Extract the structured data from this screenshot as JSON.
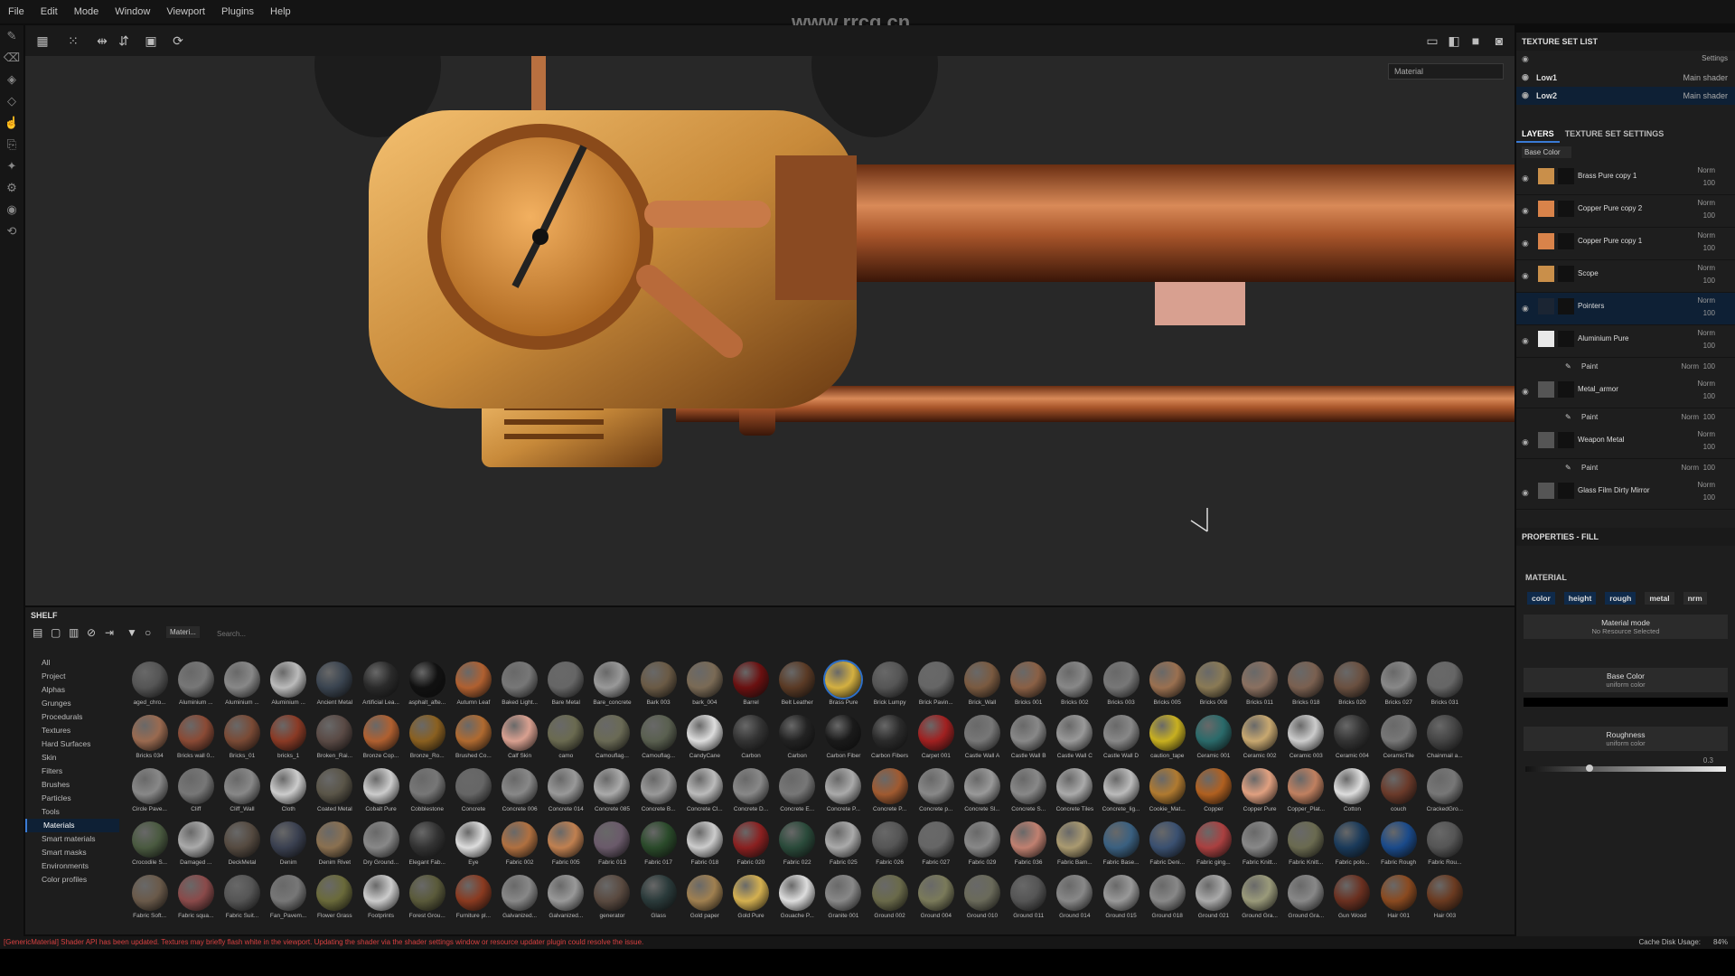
{
  "menu": [
    "File",
    "Edit",
    "Mode",
    "Window",
    "Viewport",
    "Plugins",
    "Help"
  ],
  "watermark": "www.rrcg.cn",
  "viewport": {
    "mode_select": "Material"
  },
  "texture_set_list": {
    "title": "TEXTURE SET LIST",
    "settings": "Settings",
    "items": [
      {
        "name": "Low1",
        "shader": "Main shader"
      },
      {
        "name": "Low2",
        "shader": "Main shader"
      }
    ]
  },
  "layers_panel": {
    "tabs": [
      "LAYERS",
      "TEXTURE SET SETTINGS"
    ],
    "channel": "Base Color",
    "layers": [
      {
        "name": "Brass Pure copy 1",
        "blend": "Norm",
        "opacity": "100",
        "color": "#c98f4a"
      },
      {
        "name": "Copper Pure copy 2",
        "blend": "Norm",
        "opacity": "100",
        "color": "#d9834a"
      },
      {
        "name": "Copper Pure copy 1",
        "blend": "Norm",
        "opacity": "100",
        "color": "#d9834a"
      },
      {
        "name": "Scope",
        "blend": "Norm",
        "opacity": "100",
        "color": "#c98f4a"
      },
      {
        "name": "Pointers",
        "blend": "Norm",
        "opacity": "100",
        "color": "#1b2533"
      },
      {
        "name": "Aluminium Pure",
        "blend": "Norm",
        "opacity": "100",
        "color": "#e8e8e8"
      },
      {
        "name": "Metal_armor",
        "blend": "Norm",
        "opacity": "100",
        "color": "#555"
      },
      {
        "name": "Weapon Metal",
        "blend": "Norm",
        "opacity": "100",
        "color": "#555"
      },
      {
        "name": "Glass Film Dirty Mirror",
        "blend": "Norm",
        "opacity": "100",
        "color": "#555"
      }
    ],
    "paint_label": "Paint",
    "paint_blend": "Norm",
    "paint_opacity": "100"
  },
  "properties": {
    "title": "PROPERTIES - FILL",
    "section": "MATERIAL",
    "channels": [
      "color",
      "height",
      "rough",
      "metal",
      "nrm"
    ],
    "material_mode": "Material mode",
    "no_resource": "No Resource Selected",
    "base_color": "Base Color",
    "uniform_color": "uniform color",
    "roughness": "Roughness",
    "roughness_value": "0.3"
  },
  "shelf": {
    "title": "SHELF",
    "filter_tag": "Materi...",
    "search_placeholder": "Search...",
    "categories": [
      "All",
      "Project",
      "Alphas",
      "Grunges",
      "Procedurals",
      "Textures",
      "Hard Surfaces",
      "Skin",
      "Filters",
      "Brushes",
      "Particles",
      "Tools",
      "Materials",
      "Smart materials",
      "Smart masks",
      "Environments",
      "Color profiles"
    ],
    "selected_category": "Materials",
    "materials": [
      {
        "n": "aged_chro...",
        "c": "#555"
      },
      {
        "n": "Aluminium ...",
        "c": "#777"
      },
      {
        "n": "Aluminium ...",
        "c": "#888"
      },
      {
        "n": "Aluminium ...",
        "c": "#bbb"
      },
      {
        "n": "Ancient Metal",
        "c": "#3a4450"
      },
      {
        "n": "Artificial Lea...",
        "c": "#2a2a2a"
      },
      {
        "n": "asphalt_afte...",
        "c": "#111"
      },
      {
        "n": "Autumn Leaf",
        "c": "#b06030"
      },
      {
        "n": "Baked Light...",
        "c": "#777"
      },
      {
        "n": "Bare Metal",
        "c": "#666"
      },
      {
        "n": "Bare_concrete",
        "c": "#999"
      },
      {
        "n": "Bark 003",
        "c": "#6a5a45"
      },
      {
        "n": "bark_004",
        "c": "#7a6a55"
      },
      {
        "n": "Barrel",
        "c": "#6a1010"
      },
      {
        "n": "Belt Leather",
        "c": "#5a3a25"
      },
      {
        "n": "Brass Pure",
        "c": "#d4b040"
      },
      {
        "n": "Brick Lumpy",
        "c": "#555"
      },
      {
        "n": "Brick Pavin...",
        "c": "#666"
      },
      {
        "n": "Brick_Wall",
        "c": "#7a5a40"
      },
      {
        "n": "Bricks 001",
        "c": "#8a6045"
      },
      {
        "n": "Bricks 002",
        "c": "#888"
      },
      {
        "n": "Bricks 003",
        "c": "#777"
      },
      {
        "n": "Bricks 005",
        "c": "#9a7050"
      },
      {
        "n": "Bricks 008",
        "c": "#8a7a55"
      },
      {
        "n": "Bricks 011",
        "c": "#8a7060"
      },
      {
        "n": "Bricks 018",
        "c": "#7a6050"
      },
      {
        "n": "Bricks 020",
        "c": "#6a5040"
      },
      {
        "n": "Bricks 027",
        "c": "#888"
      },
      {
        "n": "Bricks 031",
        "c": "#666"
      },
      {
        "n": "Bricks 034",
        "c": "#9a6a50"
      },
      {
        "n": "Bricks wall 0...",
        "c": "#8a4a35"
      },
      {
        "n": "Bricks_01",
        "c": "#7a4a35"
      },
      {
        "n": "bricks_1",
        "c": "#8a3a25"
      },
      {
        "n": "Broken_Rai...",
        "c": "#5a4a45"
      },
      {
        "n": "Bronze Cop...",
        "c": "#b06030"
      },
      {
        "n": "Bronze_Ro...",
        "c": "#8a6020"
      },
      {
        "n": "Brushed Co...",
        "c": "#b06a30"
      },
      {
        "n": "Calf Skin",
        "c": "#d9a090"
      },
      {
        "n": "camo",
        "c": "#6a6a50"
      },
      {
        "n": "Camouflag...",
        "c": "#6a6a55"
      },
      {
        "n": "Camouflag...",
        "c": "#5a6050"
      },
      {
        "n": "CandyCane",
        "c": "#ddd"
      },
      {
        "n": "Carbon",
        "c": "#333"
      },
      {
        "n": "Carbon",
        "c": "#222"
      },
      {
        "n": "Carbon Fiber",
        "c": "#1a1a1a"
      },
      {
        "n": "Carbon Fibers",
        "c": "#2a2a2a"
      },
      {
        "n": "Carpet 001",
        "c": "#a02020"
      },
      {
        "n": "Castle Wall A",
        "c": "#777"
      },
      {
        "n": "Castle Wall B",
        "c": "#888"
      },
      {
        "n": "Castle Wall C",
        "c": "#999"
      },
      {
        "n": "Castle Wall D",
        "c": "#888"
      },
      {
        "n": "caution_tape",
        "c": "#c8b020"
      },
      {
        "n": "Ceramic 001",
        "c": "#2a6a6a"
      },
      {
        "n": "Ceramic 002",
        "c": "#c8a870"
      },
      {
        "n": "Ceramic 003",
        "c": "#ccc"
      },
      {
        "n": "Ceramic 004",
        "c": "#333"
      },
      {
        "n": "CeramicTile",
        "c": "#777"
      },
      {
        "n": "Chainmail a...",
        "c": "#444"
      },
      {
        "n": "Circle Pave...",
        "c": "#888"
      },
      {
        "n": "Cliff",
        "c": "#777"
      },
      {
        "n": "Cliff_Wall",
        "c": "#888"
      },
      {
        "n": "Cloth",
        "c": "#ccc"
      },
      {
        "n": "Coated Metal",
        "c": "#5a5548"
      },
      {
        "n": "Cobalt Pure",
        "c": "#ccc"
      },
      {
        "n": "Cobblestone",
        "c": "#777"
      },
      {
        "n": "Concrete",
        "c": "#666"
      },
      {
        "n": "Concrete 006",
        "c": "#888"
      },
      {
        "n": "Concrete 014",
        "c": "#999"
      },
      {
        "n": "Concrete 085",
        "c": "#aaa"
      },
      {
        "n": "Concrete B...",
        "c": "#999"
      },
      {
        "n": "Concrete Cl...",
        "c": "#bbb"
      },
      {
        "n": "Concrete D...",
        "c": "#888"
      },
      {
        "n": "Concrete E...",
        "c": "#777"
      },
      {
        "n": "Concrete P...",
        "c": "#aaa"
      },
      {
        "n": "Concrete P...",
        "c": "#a05a30"
      },
      {
        "n": "Concrete p...",
        "c": "#888"
      },
      {
        "n": "Concrete Sl...",
        "c": "#999"
      },
      {
        "n": "Concrete S...",
        "c": "#888"
      },
      {
        "n": "Concrete Tiles",
        "c": "#aaa"
      },
      {
        "n": "Concrete_lig...",
        "c": "#bbb"
      },
      {
        "n": "Cookie_Mat...",
        "c": "#b07a30"
      },
      {
        "n": "Copper",
        "c": "#b06020"
      },
      {
        "n": "Copper Pure",
        "c": "#e0a080"
      },
      {
        "n": "Copper_Plat...",
        "c": "#c08060"
      },
      {
        "n": "Cotton",
        "c": "#ddd"
      },
      {
        "n": "couch",
        "c": "#6a3a2a"
      },
      {
        "n": "CrackedGro...",
        "c": "#777"
      },
      {
        "n": "Crocodile S...",
        "c": "#4a5a40"
      },
      {
        "n": "Damaged ...",
        "c": "#aaa"
      },
      {
        "n": "DeckMetal",
        "c": "#554a40"
      },
      {
        "n": "Denim",
        "c": "#3a4050"
      },
      {
        "n": "Denim Rivet",
        "c": "#8a7050"
      },
      {
        "n": "Dry Ground...",
        "c": "#888"
      },
      {
        "n": "Elegant Fab...",
        "c": "#333"
      },
      {
        "n": "Eye",
        "c": "#ddd"
      },
      {
        "n": "Fabric 002",
        "c": "#b07040"
      },
      {
        "n": "Fabric 005",
        "c": "#c08050"
      },
      {
        "n": "Fabric 013",
        "c": "#6a5a6a"
      },
      {
        "n": "Fabric 017",
        "c": "#2a4a2a"
      },
      {
        "n": "Fabric 018",
        "c": "#ccc"
      },
      {
        "n": "Fabric 020",
        "c": "#8a2020"
      },
      {
        "n": "Fabric 022",
        "c": "#2a4a3a"
      },
      {
        "n": "Fabric 025",
        "c": "#aaa"
      },
      {
        "n": "Fabric 026",
        "c": "#555"
      },
      {
        "n": "Fabric 027",
        "c": "#666"
      },
      {
        "n": "Fabric 029",
        "c": "#888"
      },
      {
        "n": "Fabric 036",
        "c": "#c08070"
      },
      {
        "n": "Fabric Bam...",
        "c": "#aa9a70"
      },
      {
        "n": "Fabric Base...",
        "c": "#3a6080"
      },
      {
        "n": "Fabric Deni...",
        "c": "#3a5070"
      },
      {
        "n": "Fabric ging...",
        "c": "#aa4040"
      },
      {
        "n": "Fabric Knitt...",
        "c": "#888"
      },
      {
        "n": "Fabric Knitt...",
        "c": "#6a6a50"
      },
      {
        "n": "Fabric polo...",
        "c": "#1a3a5a"
      },
      {
        "n": "Fabric Rough",
        "c": "#1a4a8a"
      },
      {
        "n": "Fabric Rou...",
        "c": "#555"
      },
      {
        "n": "Fabric Soft...",
        "c": "#6a5a4a"
      },
      {
        "n": "Fabric squa...",
        "c": "#8a4a4a"
      },
      {
        "n": "Fabric Suit...",
        "c": "#555"
      },
      {
        "n": "Fan_Pavem...",
        "c": "#777"
      },
      {
        "n": "Flower Grass",
        "c": "#6a6a3a"
      },
      {
        "n": "Footprints",
        "c": "#ccc"
      },
      {
        "n": "Forest Grou...",
        "c": "#5a5a3a"
      },
      {
        "n": "Furniture pl...",
        "c": "#8a3a20"
      },
      {
        "n": "Galvanized...",
        "c": "#888"
      },
      {
        "n": "Galvanized...",
        "c": "#999"
      },
      {
        "n": "generator",
        "c": "#5a4a40"
      },
      {
        "n": "Glass",
        "c": "#2a3a3a"
      },
      {
        "n": "Gold paper",
        "c": "#a08050"
      },
      {
        "n": "Gold Pure",
        "c": "#d4b050"
      },
      {
        "n": "Gouache P...",
        "c": "#ddd"
      },
      {
        "n": "Granite 001",
        "c": "#888"
      },
      {
        "n": "Ground 002",
        "c": "#6a6a4a"
      },
      {
        "n": "Ground 004",
        "c": "#7a7a5a"
      },
      {
        "n": "Ground 010",
        "c": "#6a6a5a"
      },
      {
        "n": "Ground 011",
        "c": "#555"
      },
      {
        "n": "Ground 014",
        "c": "#888"
      },
      {
        "n": "Ground 015",
        "c": "#999"
      },
      {
        "n": "Ground 018",
        "c": "#888"
      },
      {
        "n": "Ground 021",
        "c": "#aaa"
      },
      {
        "n": "Ground Gra...",
        "c": "#9a9a7a"
      },
      {
        "n": "Ground Gra...",
        "c": "#888"
      },
      {
        "n": "Gun Wood",
        "c": "#6a3020"
      },
      {
        "n": "Hair 001",
        "c": "#8a4a20"
      },
      {
        "n": "Hair 003",
        "c": "#6a3a20"
      }
    ]
  },
  "status": {
    "message": "[GenericMaterial] Shader API has been updated. Textures may briefly flash white in the viewport. Updating the shader via the shader settings window or resource updater plugin could resolve the issue.",
    "cache": "Cache Disk Usage:",
    "cache_value": "84%"
  }
}
